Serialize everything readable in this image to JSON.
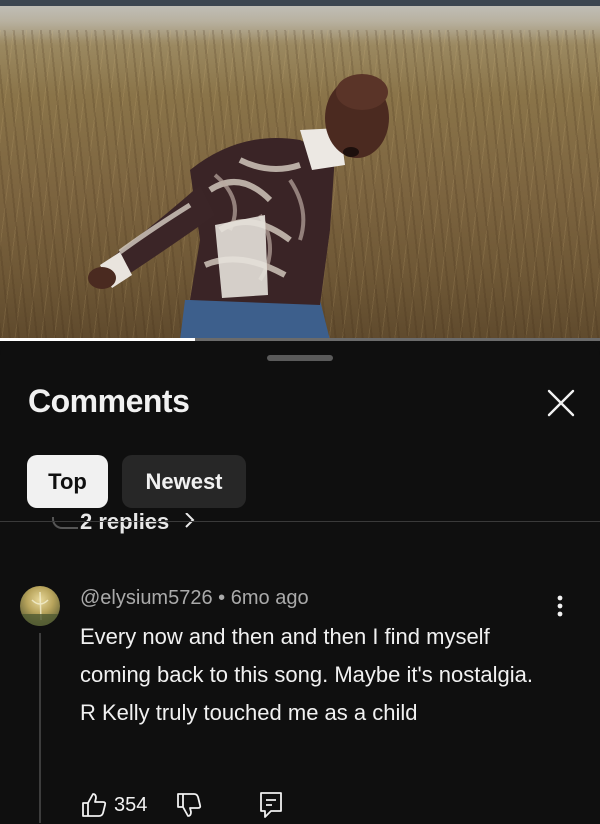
{
  "video": {
    "progress_fraction": 0.325
  },
  "comments_panel": {
    "title": "Comments",
    "sort_chips": [
      {
        "label": "Top",
        "selected": true
      },
      {
        "label": "Newest",
        "selected": false
      }
    ],
    "replies_link": "2 replies",
    "comment": {
      "author": "@elysium5726",
      "separator": "•",
      "time": "6mo ago",
      "text": "Every now and then and then I find myself coming back to this song. Maybe it's nostalgia. R Kelly truly touched me as a child",
      "likes": "354"
    }
  },
  "icons": {
    "close": "close-icon",
    "more": "more-vert-icon",
    "like": "thumb-up-icon",
    "dislike": "thumb-down-icon",
    "reply": "reply-icon",
    "chevron": "chevron-right-icon"
  },
  "colors": {
    "background": "#0f0f0f",
    "text_primary": "#f1f1f1",
    "text_secondary": "#aaaaaa",
    "chip_selected_bg": "#f1f1f1",
    "chip_bg": "#272727"
  }
}
